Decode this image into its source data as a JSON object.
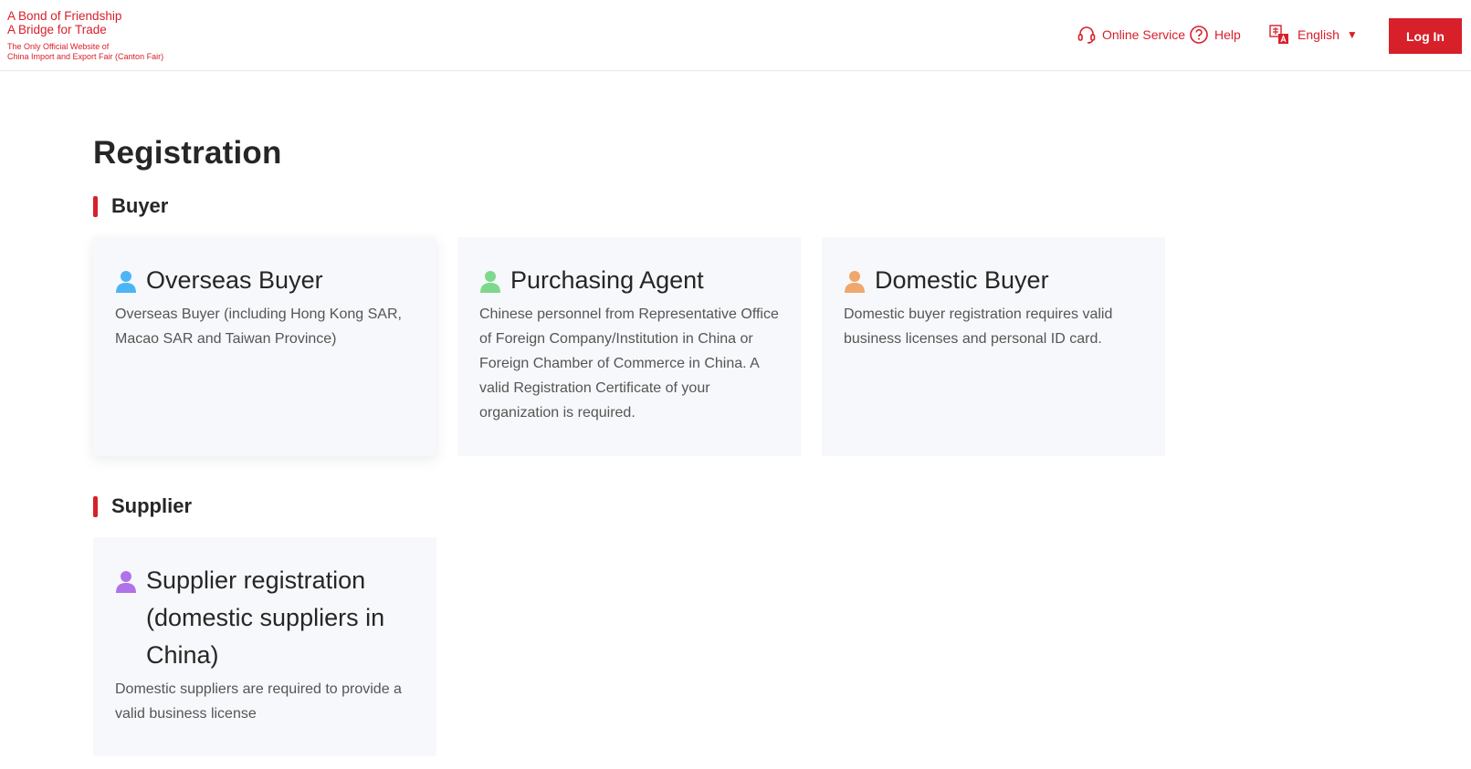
{
  "logo": {
    "line1": "A Bond of Friendship",
    "line2": "A Bridge for Trade",
    "line3": "The Only Official Website of",
    "line4": "China Import and Export Fair (Canton Fair)"
  },
  "nav": {
    "online_service": "Online Service",
    "help": "Help",
    "language": "English",
    "login": "Log In"
  },
  "colors": {
    "brand_red": "#d7202a",
    "card_bg": "#f7f8fb",
    "overseas_icon": "#4cb5f5",
    "agent_icon": "#7ed88b",
    "domestic_icon": "#f0a76b",
    "supplier_icon": "#b072e8"
  },
  "page": {
    "title": "Registration",
    "buyer_section": "Buyer",
    "supplier_section": "Supplier"
  },
  "cards": {
    "overseas": {
      "icon": "person-icon",
      "title": "Overseas Buyer",
      "desc": "Overseas Buyer (including Hong Kong SAR, Macao SAR and Taiwan Province)"
    },
    "agent": {
      "icon": "person-icon",
      "title": "Purchasing Agent",
      "desc": "Chinese personnel from Representative Office of Foreign Company/Institution in China or Foreign Chamber of Commerce in China. A valid Registration Certificate of your organization is required."
    },
    "domestic": {
      "icon": "person-icon",
      "title": "Domestic Buyer",
      "desc": "Domestic buyer registration requires valid business licenses and personal ID card."
    },
    "supplier": {
      "icon": "person-icon",
      "title": "Supplier registration (domestic suppliers in China)",
      "desc": "Domestic suppliers are required to provide a valid business license"
    }
  }
}
